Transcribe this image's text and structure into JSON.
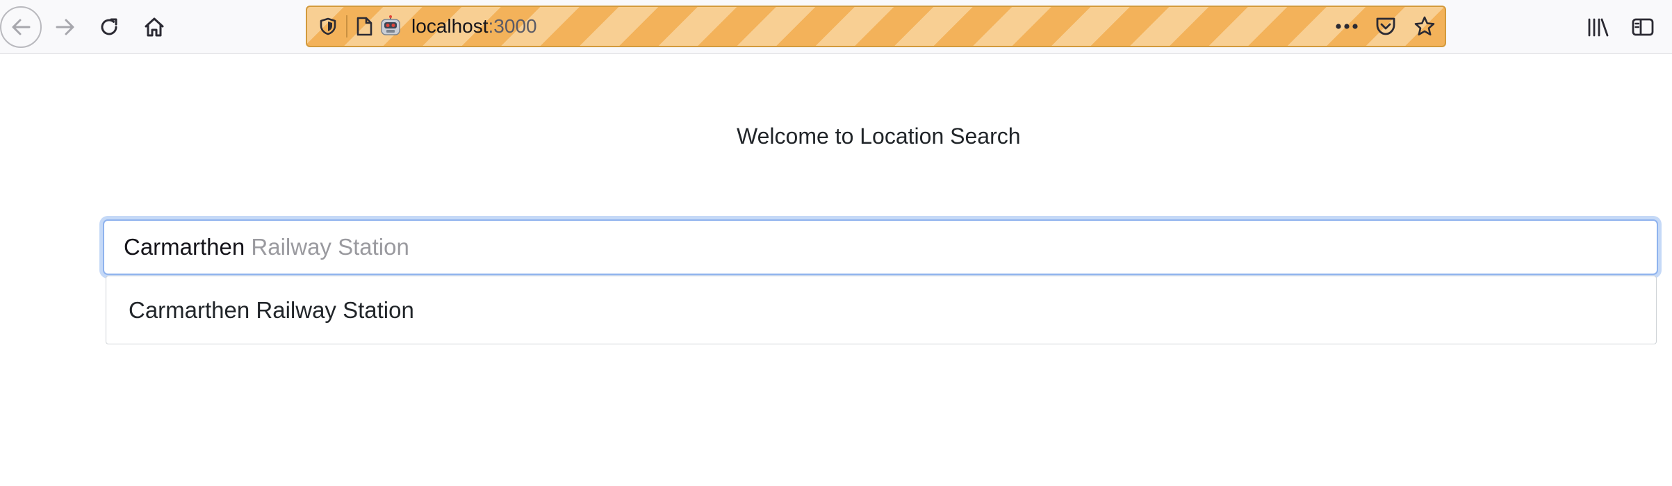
{
  "browser": {
    "url_host": "localhost",
    "url_port": ":3000",
    "icons": {
      "back": "arrow-left-icon",
      "forward": "arrow-right-icon",
      "reload": "reload-icon",
      "home": "home-icon",
      "tracking": "shield-icon",
      "page": "document-icon",
      "remote": "robot-icon",
      "more": "ellipsis-icon",
      "pocket": "pocket-icon",
      "bookmark": "star-icon",
      "library": "library-icon",
      "sidebar": "sidebar-icon"
    },
    "colors": {
      "urlbar_stripe_a": "#f3b25a",
      "urlbar_stripe_b": "#f8cf93",
      "toolbar_bg": "#f9f9fb"
    }
  },
  "page": {
    "heading": "Welcome to Location Search",
    "search": {
      "typed_value": "Carmarthen",
      "autocomplete_hint": " Railway Station",
      "focus_color": "#8fb3ee"
    },
    "suggestions": [
      {
        "label": "Carmarthen Railway Station"
      }
    ]
  }
}
